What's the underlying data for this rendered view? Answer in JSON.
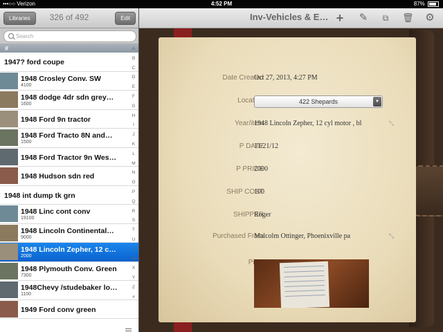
{
  "status_bar": {
    "carrier": "•••○○ Verizon",
    "time": "4:52 PM",
    "battery": "87%"
  },
  "left_toolbar": {
    "libraries_label": "Libraries",
    "counter": "326 of 492",
    "edit_label": "Edit"
  },
  "search": {
    "placeholder": "Search"
  },
  "list": {
    "section_header": "#",
    "items": [
      {
        "title": "1947? ford coupe",
        "sub": "",
        "thumb": false
      },
      {
        "title": "1948 Crosley Conv. SW",
        "sub": "4100",
        "thumb": true
      },
      {
        "title": "1948 dodge 4dr sdn grey…",
        "sub": "1600",
        "thumb": true
      },
      {
        "title": "1948 Ford 9n tractor",
        "sub": "",
        "thumb": true
      },
      {
        "title": "1948 Ford Tracto 8N and…",
        "sub": "1500",
        "thumb": true
      },
      {
        "title": "1948 Ford Tractor 9n Wes…",
        "sub": "",
        "thumb": true
      },
      {
        "title": "1948 Hudson sdn red",
        "sub": "",
        "thumb": true
      },
      {
        "title": "1948 int dump tk grn",
        "sub": "",
        "thumb": false
      },
      {
        "title": "1948 Linc cont conv",
        "sub": "19100",
        "thumb": true
      },
      {
        "title": "1948 Lincoln Continental…",
        "sub": "9000",
        "thumb": true
      },
      {
        "title": "1948 Lincoln Zepher, 12 c…",
        "sub": "2000",
        "thumb": true,
        "selected": true
      },
      {
        "title": "1948 Plymouth Conv. Green",
        "sub": "7300",
        "thumb": true
      },
      {
        "title": "1948Chevy /studebaker lo…",
        "sub": "1100",
        "thumb": true
      },
      {
        "title": "1949 Ford conv green",
        "sub": "",
        "thumb": true
      }
    ],
    "index_letters": [
      "A",
      "B",
      "C",
      "D",
      "E",
      "F",
      "G",
      "H",
      "I",
      "J",
      "K",
      "L",
      "M",
      "N",
      "O",
      "P",
      "Q",
      "R",
      "S",
      "T",
      "U",
      "V",
      "W",
      "X",
      "Y",
      "Z",
      "#"
    ]
  },
  "right_toolbar": {
    "title": "Inv-Vehicles & E…"
  },
  "record": {
    "date_created": {
      "label": "Date Created",
      "value": "Oct 27, 2013, 4:27 PM"
    },
    "location": {
      "label": "Location",
      "value": "422 Shepards"
    },
    "year_item": {
      "label": "Year/item",
      "value": "1948 Lincoln Zepher, 12 cyl motor , bl"
    },
    "p_date": {
      "label": "P DATE",
      "value": "11/21/12"
    },
    "p_price": {
      "label": "P PRICE",
      "value": "2000"
    },
    "ship_cost": {
      "label": "SHIP COST",
      "value": "100"
    },
    "shipper": {
      "label": "SHIPPER",
      "value": "Roger"
    },
    "purchased_from": {
      "label": "Purchased From",
      "value": "Malcolm Ottinger, Phoenixville pa"
    },
    "pic1": {
      "label": "Pic 1"
    }
  },
  "colors": {
    "selection": "#0b62cf",
    "page": "#efe3c6",
    "cover": "#3b2b1f"
  }
}
